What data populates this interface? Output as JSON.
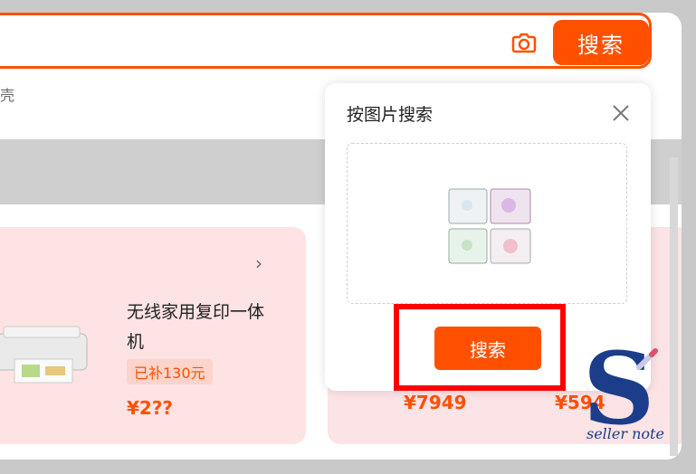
{
  "search": {
    "button_label": "搜索",
    "hint_text": "壳"
  },
  "promo": {
    "title": "无线家用复印一体机",
    "subsidy": "已补130元",
    "price": "¥2??"
  },
  "other_prices": [
    "¥7949",
    "¥594"
  ],
  "popup": {
    "title": "按图片搜索",
    "search_button": "搜索"
  },
  "watermark": {
    "letter": "S",
    "text": "seller note"
  },
  "colors": {
    "accent": "#ff5000",
    "highlight": "#ff0000",
    "watermark": "#1b3d8a"
  },
  "icons": {
    "camera": "camera-icon",
    "close": "close-icon",
    "chevron": "chevron-right-icon"
  }
}
